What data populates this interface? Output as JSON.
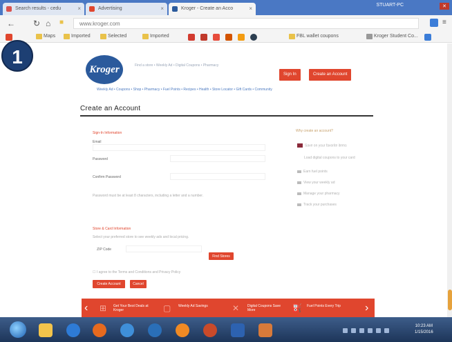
{
  "browser": {
    "tabs": [
      {
        "label": "Search results - cedu",
        "favicon_color": "#d9534f",
        "active": false
      },
      {
        "label": "Advertising",
        "favicon_color": "#e0462e",
        "active": false
      },
      {
        "label": "Kroger - Create an Acco",
        "favicon_color": "#2b5a9c",
        "active": true
      }
    ],
    "user_label": "STUART-PC",
    "address": "www.kroger.com",
    "bookmarks": [
      "Maps",
      "Imported",
      "Selected",
      "Imported"
    ],
    "bookmark_right": [
      "FBL wallet coupons",
      "Kroger Student Co..."
    ]
  },
  "step": {
    "number": "1"
  },
  "site": {
    "logo_text": "Kroger",
    "header_links": "Find a store  •  Weekly Ad  •  Digital Coupons  •  Pharmacy",
    "sign_in": "Sign In",
    "create_account": "Create an Account",
    "dept_nav": "Weekly Ad  •  Coupons  •  Shop  •  Pharmacy  •  Fuel Points  •  Recipes  •  Health  •  Store Locator  •  Gift Cards  •  Community"
  },
  "form": {
    "page_title": "Create an Account",
    "section1_label": "Sign-In Information",
    "email_label": "Email",
    "password_label": "Password",
    "confirm_label": "Confirm Password",
    "password_hint": "Password must be at least 8 characters, including a letter and a number.",
    "section2_label": "Store & Card Information",
    "store_hint": "Select your preferred store to see weekly ads and local pricing.",
    "zip_label": "ZIP Code",
    "find_store": "Find Stores",
    "terms_text": "I agree to the Terms and Conditions and Privacy Policy",
    "create_button": "Create Account",
    "cancel_button": "Cancel"
  },
  "sidebar": {
    "title": "Why create an account?",
    "items": [
      "Save on your favorite items",
      "Load digital coupons to your card",
      "Earn fuel points",
      "View your weekly ad",
      "Manage your pharmacy",
      "Track your purchases"
    ]
  },
  "promo": {
    "items": [
      "Get Your Best Deals at Kroger",
      "Weekly Ad Savings",
      "Digital Coupons Save More",
      "Fuel Points Every Trip"
    ]
  },
  "taskbar": {
    "time": "10:23 AM",
    "date": "1/15/2016"
  }
}
